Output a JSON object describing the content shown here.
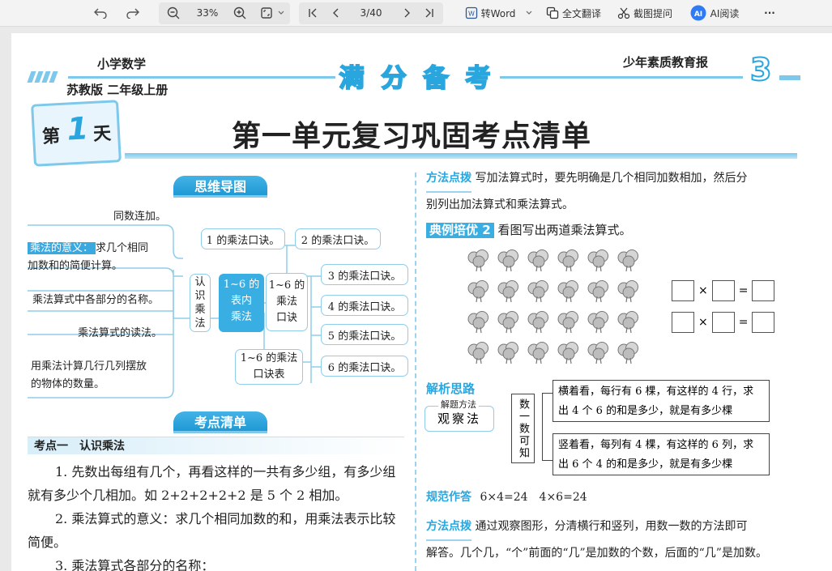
{
  "toolbar": {
    "zoom": "33%",
    "page": "3/40",
    "to_word": "转Word",
    "translate": "全文翻译",
    "screenshot_ask": "截图提问",
    "ai_read": "AI阅读",
    "more": "···"
  },
  "header": {
    "subject": "小学数学",
    "edition": "苏教版  二年级上册",
    "brand": [
      "满",
      "分",
      "备",
      "考"
    ],
    "newspaper": "少年素质教育报",
    "page_number": "3"
  },
  "day": {
    "prefix": "第",
    "number": "1",
    "suffix": "天"
  },
  "unit_title": "第一单元复习巩固考点清单",
  "mindmap": {
    "title": "思维导图",
    "left_items": [
      "同数连加。",
      "求几个相同",
      "加数和的简便计算。",
      "乘法算式中各部分的名称。",
      "乘法算式的读法。",
      "用乘法计算几行几列摆放",
      "的物体的数量。"
    ],
    "meaning_label": "乘法的意义：",
    "recognize": [
      "认",
      "识",
      "乘",
      "法"
    ],
    "center": [
      "1~6 的",
      "表内",
      "乘法"
    ],
    "formula_title": [
      "1~6 的",
      "乘法",
      "口诀"
    ],
    "table_box": [
      "1~6 的乘法",
      "口诀表"
    ],
    "rhymes": [
      "1 的乘法口诀。",
      "2 的乘法口诀。",
      "3 的乘法口诀。",
      "4 的乘法口诀。",
      "5 的乘法口诀。",
      "6 的乘法口诀。"
    ]
  },
  "checklist": {
    "title": "考点清单",
    "point_title": "考点一　认识乘法",
    "paragraphs": [
      "1. 先数出每组有几个，再看这样的一共有多少组，有多少组",
      "就有多少个几相加。如 2+2+2+2+2 是 5 个 2 相加。",
      "2. 乘法算式的意义：求几个相同加数的和，用乘法表示比较",
      "简便。",
      "3. 乘法算式各部分的名称："
    ]
  },
  "right": {
    "tip1_tag": "方法点拨",
    "tip1_line1": "写加法算式时，要先明确是几个相同加数相加，然后分",
    "tip1_line2": "别列出加法算式和乘法算式。",
    "example_tag": "典例培优 2",
    "example_text": "看图写出两道乘法算式。",
    "times_sign": "×",
    "equals_sign": "=",
    "think_tag": "解析思路",
    "method_label": "解题方法",
    "method": "观察法",
    "count_label": "数一数可知",
    "explain1": "横着看，每行有 6 棵，有这样的 4 行，求出 4 个 6 的和是多少，就是有多少棵",
    "explain2": "竖着看，每列有 4 棵，有这样的 6 列，求出 6 个 4 的和是多少，就是有多少棵",
    "answer_tag": "规范作答",
    "answer": "6×4=24　4×6=24",
    "tip2_tag": "方法点拨",
    "tip2_line1": "通过观察图形，分清横行和竖列，用数一数的方法即可",
    "tip2_line2": "解答。几个几，“个”前面的“几”是加数的个数，后面的“几”是加数。"
  },
  "grid": {
    "rows": 4,
    "cols": 6
  },
  "colors": {
    "accent": "#2aa6df",
    "light_accent": "#7ec8ec"
  }
}
